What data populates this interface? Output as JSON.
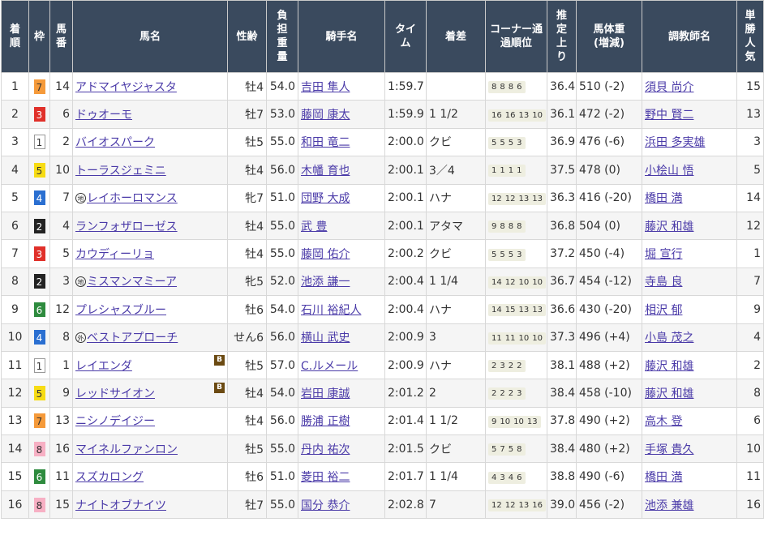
{
  "headers": {
    "rank": "着順",
    "waku": "枠",
    "umaban": "馬番",
    "horse": "馬名",
    "sexage": "性齢",
    "weight": "負担重量",
    "jockey": "騎手名",
    "time": "タイム",
    "margin": "着差",
    "corner": "コーナー通過順位",
    "last3f": "推定上り",
    "body": "馬体重(増減)",
    "trainer": "調教師名",
    "pop": "単勝人気"
  },
  "waku_colors": {
    "1": {
      "bg": "#ffffff",
      "fg": "#333333"
    },
    "2": {
      "bg": "#222222",
      "fg": "#ffffff"
    },
    "3": {
      "bg": "#e0302a",
      "fg": "#ffffff"
    },
    "4": {
      "bg": "#2a6fd1",
      "fg": "#ffffff"
    },
    "5": {
      "bg": "#f7dc14",
      "fg": "#333333"
    },
    "6": {
      "bg": "#2e8b3e",
      "fg": "#ffffff"
    },
    "7": {
      "bg": "#f59a3a",
      "fg": "#333333"
    },
    "8": {
      "bg": "#f7b0c4",
      "fg": "#333333"
    }
  },
  "rows": [
    {
      "rank": "1",
      "waku": "7",
      "umaban": "14",
      "mark": "",
      "horse": "アドマイヤジャスタ",
      "blinker": "",
      "sexage": "牡4",
      "weight": "54.0",
      "jockey": "吉田 隼人",
      "time": "1:59.7",
      "margin": "",
      "corner": [
        "8",
        "8",
        "8",
        "6"
      ],
      "last3f": "36.4",
      "body": "510 (-2)",
      "trainer": "須貝 尚介",
      "pop": "15"
    },
    {
      "rank": "2",
      "waku": "3",
      "umaban": "6",
      "mark": "",
      "horse": "ドゥオーモ",
      "blinker": "",
      "sexage": "牡7",
      "weight": "53.0",
      "jockey": "藤岡 康太",
      "time": "1:59.9",
      "margin": "1 1/2",
      "corner": [
        "16",
        "16",
        "13",
        "10"
      ],
      "last3f": "36.1",
      "body": "472 (-2)",
      "trainer": "野中 賢二",
      "pop": "13"
    },
    {
      "rank": "3",
      "waku": "1",
      "umaban": "2",
      "mark": "",
      "horse": "バイオスパーク",
      "blinker": "",
      "sexage": "牡5",
      "weight": "55.0",
      "jockey": "和田 竜二",
      "time": "2:00.0",
      "margin": "クビ",
      "corner": [
        "5",
        "5",
        "5",
        "3"
      ],
      "last3f": "36.9",
      "body": "476 (-6)",
      "trainer": "浜田 多実雄",
      "pop": "3"
    },
    {
      "rank": "4",
      "waku": "5",
      "umaban": "10",
      "mark": "",
      "horse": "トーラスジェミニ",
      "blinker": "",
      "sexage": "牡4",
      "weight": "56.0",
      "jockey": "木幡 育也",
      "time": "2:00.1",
      "margin": "3／4",
      "corner": [
        "1",
        "1",
        "1",
        "1"
      ],
      "last3f": "37.5",
      "body": "478 (0)",
      "trainer": "小桧山 悟",
      "pop": "5"
    },
    {
      "rank": "5",
      "waku": "4",
      "umaban": "7",
      "mark": "地",
      "horse": "レイホーロマンス",
      "blinker": "",
      "sexage": "牝7",
      "weight": "51.0",
      "jockey": "団野 大成",
      "time": "2:00.1",
      "margin": "ハナ",
      "corner": [
        "12",
        "12",
        "13",
        "13"
      ],
      "last3f": "36.3",
      "body": "416 (-20)",
      "trainer": "橋田 満",
      "pop": "14"
    },
    {
      "rank": "6",
      "waku": "2",
      "umaban": "4",
      "mark": "",
      "horse": "ランフォザローゼス",
      "blinker": "",
      "sexage": "牡4",
      "weight": "55.0",
      "jockey": "武 豊",
      "time": "2:00.1",
      "margin": "アタマ",
      "corner": [
        "9",
        "8",
        "8",
        "8"
      ],
      "last3f": "36.8",
      "body": "504 (0)",
      "trainer": "藤沢 和雄",
      "pop": "12"
    },
    {
      "rank": "7",
      "waku": "3",
      "umaban": "5",
      "mark": "",
      "horse": "カウディーリョ",
      "blinker": "",
      "sexage": "牡4",
      "weight": "55.0",
      "jockey": "藤岡 佑介",
      "time": "2:00.2",
      "margin": "クビ",
      "corner": [
        "5",
        "5",
        "5",
        "3"
      ],
      "last3f": "37.2",
      "body": "450 (-4)",
      "trainer": "堀 宣行",
      "pop": "1"
    },
    {
      "rank": "8",
      "waku": "2",
      "umaban": "3",
      "mark": "地",
      "horse": "ミスマンマミーア",
      "blinker": "",
      "sexage": "牝5",
      "weight": "52.0",
      "jockey": "池添 謙一",
      "time": "2:00.4",
      "margin": "1 1/4",
      "corner": [
        "14",
        "12",
        "10",
        "10"
      ],
      "last3f": "36.7",
      "body": "454 (-12)",
      "trainer": "寺島 良",
      "pop": "7"
    },
    {
      "rank": "9",
      "waku": "6",
      "umaban": "12",
      "mark": "",
      "horse": "プレシャスブルー",
      "blinker": "",
      "sexage": "牡6",
      "weight": "54.0",
      "jockey": "石川 裕紀人",
      "time": "2:00.4",
      "margin": "ハナ",
      "corner": [
        "14",
        "15",
        "13",
        "13"
      ],
      "last3f": "36.6",
      "body": "430 (-20)",
      "trainer": "相沢 郁",
      "pop": "9"
    },
    {
      "rank": "10",
      "waku": "4",
      "umaban": "8",
      "mark": "外",
      "horse": "ベストアプローチ",
      "blinker": "",
      "sexage": "せん6",
      "weight": "56.0",
      "jockey": "横山 武史",
      "time": "2:00.9",
      "margin": "3",
      "corner": [
        "11",
        "11",
        "10",
        "10"
      ],
      "last3f": "37.3",
      "body": "496 (+4)",
      "trainer": "小島 茂之",
      "pop": "4"
    },
    {
      "rank": "11",
      "waku": "1",
      "umaban": "1",
      "mark": "",
      "horse": "レイエンダ",
      "blinker": "B",
      "sexage": "牡5",
      "weight": "57.0",
      "jockey": "C.ルメール",
      "time": "2:00.9",
      "margin": "ハナ",
      "corner": [
        "2",
        "3",
        "2",
        "2"
      ],
      "last3f": "38.1",
      "body": "488 (+2)",
      "trainer": "藤沢 和雄",
      "pop": "2"
    },
    {
      "rank": "12",
      "waku": "5",
      "umaban": "9",
      "mark": "",
      "horse": "レッドサイオン",
      "blinker": "B",
      "sexage": "牡4",
      "weight": "54.0",
      "jockey": "岩田 康誠",
      "time": "2:01.2",
      "margin": "2",
      "corner": [
        "2",
        "2",
        "2",
        "3"
      ],
      "last3f": "38.4",
      "body": "458 (-10)",
      "trainer": "藤沢 和雄",
      "pop": "8"
    },
    {
      "rank": "13",
      "waku": "7",
      "umaban": "13",
      "mark": "",
      "horse": "ニシノデイジー",
      "blinker": "",
      "sexage": "牡4",
      "weight": "56.0",
      "jockey": "勝浦 正樹",
      "time": "2:01.4",
      "margin": "1 1/2",
      "corner": [
        "9",
        "10",
        "10",
        "13"
      ],
      "last3f": "37.8",
      "body": "490 (+2)",
      "trainer": "高木 登",
      "pop": "6"
    },
    {
      "rank": "14",
      "waku": "8",
      "umaban": "16",
      "mark": "",
      "horse": "マイネルファンロン",
      "blinker": "",
      "sexage": "牡5",
      "weight": "55.0",
      "jockey": "丹内 祐次",
      "time": "2:01.5",
      "margin": "クビ",
      "corner": [
        "5",
        "7",
        "5",
        "8"
      ],
      "last3f": "38.4",
      "body": "480 (+2)",
      "trainer": "手塚 貴久",
      "pop": "10"
    },
    {
      "rank": "15",
      "waku": "6",
      "umaban": "11",
      "mark": "",
      "horse": "スズカロング",
      "blinker": "",
      "sexage": "牡6",
      "weight": "51.0",
      "jockey": "菱田 裕二",
      "time": "2:01.7",
      "margin": "1 1/4",
      "corner": [
        "4",
        "3",
        "4",
        "6"
      ],
      "last3f": "38.8",
      "body": "490 (-6)",
      "trainer": "橋田 満",
      "pop": "11"
    },
    {
      "rank": "16",
      "waku": "8",
      "umaban": "15",
      "mark": "",
      "horse": "ナイトオブナイツ",
      "blinker": "",
      "sexage": "牡7",
      "weight": "55.0",
      "jockey": "国分 恭介",
      "time": "2:02.8",
      "margin": "7",
      "corner": [
        "12",
        "12",
        "13",
        "16"
      ],
      "last3f": "39.0",
      "body": "456 (-2)",
      "trainer": "池添 兼雄",
      "pop": "16"
    }
  ]
}
